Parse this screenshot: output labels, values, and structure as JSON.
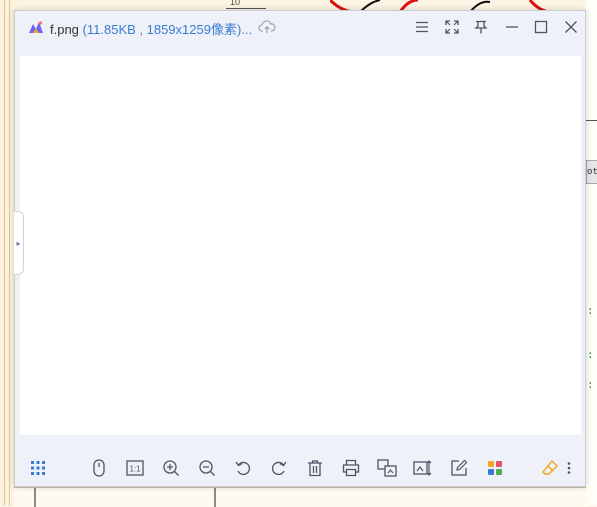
{
  "window": {
    "file_name": "f.png",
    "file_meta": "(11.85KB , 1859x1259像素)...",
    "titlebar_buttons": [
      "menu-icon",
      "fullscreen-icon",
      "pin-icon",
      "minimize-icon",
      "maximize-icon",
      "close-icon"
    ]
  },
  "toolbar": {
    "left_tool": "grid-icon",
    "tools": [
      "mouse-icon",
      "actual-size-icon",
      "zoom-in-icon",
      "zoom-out-icon",
      "rotate-left-icon",
      "rotate-right-icon",
      "delete-icon",
      "print-icon",
      "convert-icon",
      "compress-icon",
      "edit-icon",
      "apps-icon"
    ],
    "actual_size_label": "1:1",
    "right_tools": [
      "eraser-icon",
      "more-icon"
    ]
  },
  "background": {
    "top_fragment_text": "10",
    "right_tag_text": "ot",
    "right_code_fragments": [
      ":",
      ":",
      ":"
    ]
  },
  "colors": {
    "accent": "#3b7bd6",
    "icon": "#4a5568",
    "window_bg": "#eef1f7",
    "canvas_bg": "#ffffff"
  }
}
